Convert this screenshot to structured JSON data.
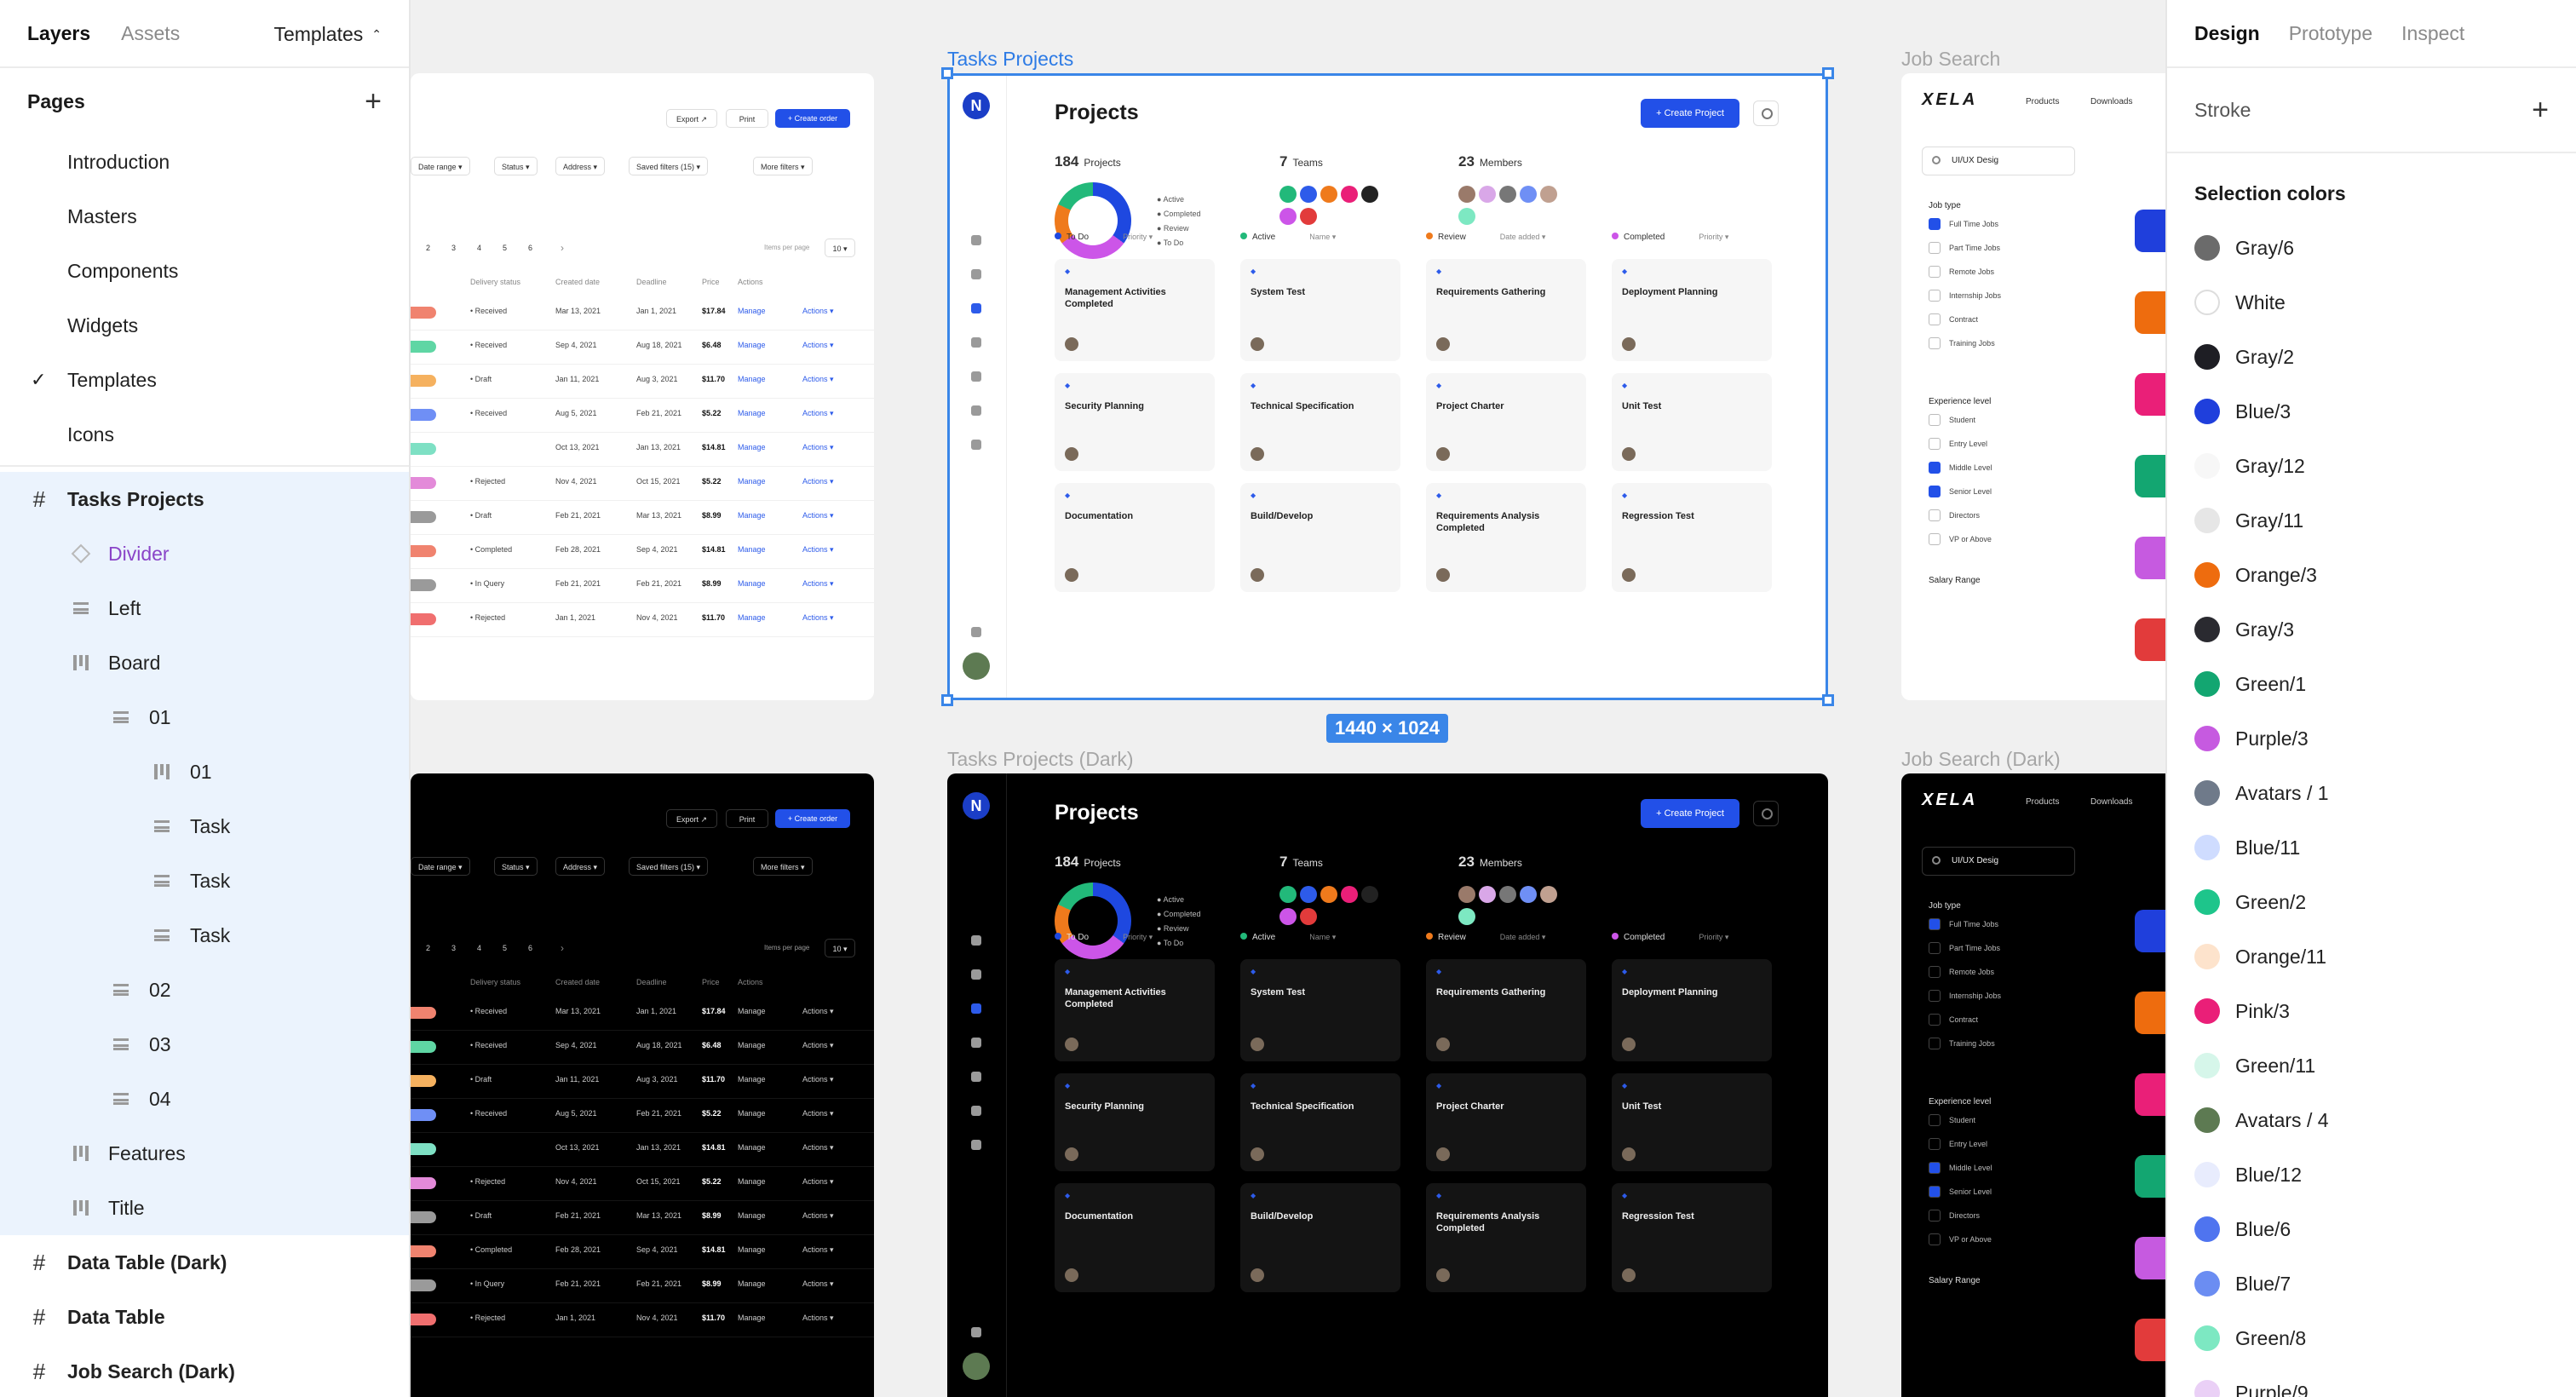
{
  "left_panel": {
    "tabs": [
      "Layers",
      "Assets"
    ],
    "templates_label": "Templates",
    "pages_title": "Pages",
    "pages": [
      "Introduction",
      "Masters",
      "Components",
      "Widgets",
      "Templates",
      "Icons"
    ],
    "layers": [
      {
        "label": "Tasks Projects",
        "icon": "frame-icon"
      },
      {
        "label": "Divider",
        "icon": "component-icon"
      },
      {
        "label": "Left",
        "icon": "rows-icon"
      },
      {
        "label": "Board",
        "icon": "columns-icon"
      },
      {
        "label": "01",
        "icon": "rows-icon"
      },
      {
        "label": "01",
        "icon": "columns-icon"
      },
      {
        "label": "Task",
        "icon": "rows-icon"
      },
      {
        "label": "Task",
        "icon": "rows-icon"
      },
      {
        "label": "Task",
        "icon": "rows-icon"
      },
      {
        "label": "02",
        "icon": "rows-icon"
      },
      {
        "label": "03",
        "icon": "rows-icon"
      },
      {
        "label": "04",
        "icon": "rows-icon"
      },
      {
        "label": "Features",
        "icon": "columns-icon"
      },
      {
        "label": "Title",
        "icon": "columns-icon"
      },
      {
        "label": "Data Table (Dark)",
        "icon": "frame-icon"
      },
      {
        "label": "Data Table",
        "icon": "frame-icon"
      },
      {
        "label": "Job Search (Dark)",
        "icon": "frame-icon"
      }
    ]
  },
  "right_panel": {
    "tabs": [
      "Design",
      "Prototype",
      "Inspect"
    ],
    "stroke_label": "Stroke",
    "selection_colors_title": "Selection colors",
    "colors": [
      {
        "name": "Gray/6",
        "hex": "#6b6b6b"
      },
      {
        "name": "White",
        "hex": "#ffffff"
      },
      {
        "name": "Gray/2",
        "hex": "#1e1e24"
      },
      {
        "name": "Blue/3",
        "hex": "#1f3fdc"
      },
      {
        "name": "Gray/12",
        "hex": "#f7f7f7"
      },
      {
        "name": "Gray/11",
        "hex": "#e6e6e6"
      },
      {
        "name": "Orange/3",
        "hex": "#ee6c0e"
      },
      {
        "name": "Gray/3",
        "hex": "#2a2a30"
      },
      {
        "name": "Green/1",
        "hex": "#13a671"
      },
      {
        "name": "Purple/3",
        "hex": "#c65ae0"
      },
      {
        "name": "Avatars / 1",
        "hex": "#6f7a8a"
      },
      {
        "name": "Blue/11",
        "hex": "#cfdcff"
      },
      {
        "name": "Green/2",
        "hex": "#1ec58b"
      },
      {
        "name": "Orange/11",
        "hex": "#fde3cc"
      },
      {
        "name": "Pink/3",
        "hex": "#ea1f78"
      },
      {
        "name": "Green/11",
        "hex": "#d6f6ea"
      },
      {
        "name": "Avatars / 4",
        "hex": "#5d7a52"
      },
      {
        "name": "Blue/12",
        "hex": "#e8ecfd"
      },
      {
        "name": "Blue/6",
        "hex": "#4f74ef"
      },
      {
        "name": "Blue/7",
        "hex": "#6b8df2"
      },
      {
        "name": "Green/8",
        "hex": "#7de8c2"
      },
      {
        "name": "Purple/9",
        "hex": "#ead0f6"
      }
    ]
  },
  "canvas": {
    "frames": {
      "tasks": "Tasks Projects",
      "tasks_dark": "Tasks Projects (Dark)",
      "job": "Job Search",
      "job_dark": "Job Search (Dark)"
    },
    "dimension_badge": "1440 × 1024",
    "tasks_frame": {
      "title": "Projects",
      "create_label": "+ Create Project",
      "stats": [
        {
          "num": "184",
          "label": "Projects"
        },
        {
          "num": "7",
          "label": "Teams"
        },
        {
          "num": "23",
          "label": "Members"
        }
      ],
      "legend": [
        "Active",
        "Completed",
        "Review",
        "To Do"
      ],
      "columns": [
        {
          "name": "To Do",
          "color": "#1e48e0",
          "sort": "Priority"
        },
        {
          "name": "Active",
          "color": "#22b97a",
          "sort": "Name"
        },
        {
          "name": "Review",
          "color": "#ef7a1c",
          "sort": "Date added"
        },
        {
          "name": "Completed",
          "color": "#cc55e8",
          "sort": "Priority"
        }
      ],
      "cards": [
        [
          "Management Activities Completed",
          "Security Planning",
          "Documentation"
        ],
        [
          "System Test",
          "Technical Specification",
          "Build/Develop"
        ],
        [
          "Requirements Gathering",
          "Project Charter",
          "Requirements Analysis Completed"
        ],
        [
          "Deployment Planning",
          "Unit Test",
          "Regression Test"
        ]
      ]
    },
    "data_table": {
      "export": "Export",
      "print": "Print",
      "create_order": "+ Create order",
      "filters": [
        "Date range",
        "Status",
        "Address",
        "Saved filters (15)",
        "More filters"
      ],
      "pages": [
        "2",
        "3",
        "4",
        "5",
        "6"
      ],
      "headers": [
        "Delivery status",
        "Created date",
        "Deadline",
        "Price",
        "Actions"
      ],
      "rows": [
        {
          "status": "Received",
          "created": "Mar 13, 2021",
          "deadline": "Jan 1, 2021",
          "price": "$17.84",
          "pill": "#f0836f"
        },
        {
          "status": "Received",
          "created": "Sep 4, 2021",
          "deadline": "Aug 18, 2021",
          "price": "$6.48",
          "pill": "#5fd6a4"
        },
        {
          "status": "Draft",
          "created": "Jan 11, 2021",
          "deadline": "Aug 3, 2021",
          "price": "$11.70",
          "pill": "#f5b15f"
        },
        {
          "status": "Received",
          "created": "Aug 5, 2021",
          "deadline": "Feb 21, 2021",
          "price": "$5.22",
          "pill": "#6f8ff5"
        },
        {
          "status": "",
          "created": "Oct 13, 2021",
          "deadline": "Jan 13, 2021",
          "price": "$14.81",
          "pill": "#7ee0c4"
        },
        {
          "status": "Rejected",
          "created": "Nov 4, 2021",
          "deadline": "Oct 15, 2021",
          "price": "$5.22",
          "pill": "#e38ad9"
        },
        {
          "status": "Draft",
          "created": "Feb 21, 2021",
          "deadline": "Mar 13, 2021",
          "price": "$8.99",
          "pill": "#9a9a9a"
        },
        {
          "status": "Completed",
          "created": "Feb 28, 2021",
          "deadline": "Sep 4, 2021",
          "price": "$14.81",
          "pill": "#f0836f"
        },
        {
          "status": "In Query",
          "created": "Feb 21, 2021",
          "deadline": "Feb 21, 2021",
          "price": "$8.99",
          "pill": "#9a9a9a"
        },
        {
          "status": "Rejected",
          "created": "Jan 1, 2021",
          "deadline": "Nov 4, 2021",
          "price": "$11.70",
          "pill": "#f06f6f"
        }
      ],
      "manage": "Manage",
      "actions": "Actions",
      "items_per_page": "Items per page",
      "per_page_value": "10"
    },
    "job_search": {
      "logo": "XELA",
      "nav": [
        "Products",
        "Downloads"
      ],
      "query": "UI/UX Desig",
      "job_type_title": "Job type",
      "job_types": [
        "Full Time Jobs",
        "Part Time Jobs",
        "Remote Jobs",
        "Internship Jobs",
        "Contract",
        "Training Jobs"
      ],
      "experience_title": "Experience level",
      "experience": [
        "Student",
        "Entry Level",
        "Middle Level",
        "Senior Level",
        "Directors",
        "VP or Above"
      ],
      "salary_title": "Salary Range"
    }
  }
}
